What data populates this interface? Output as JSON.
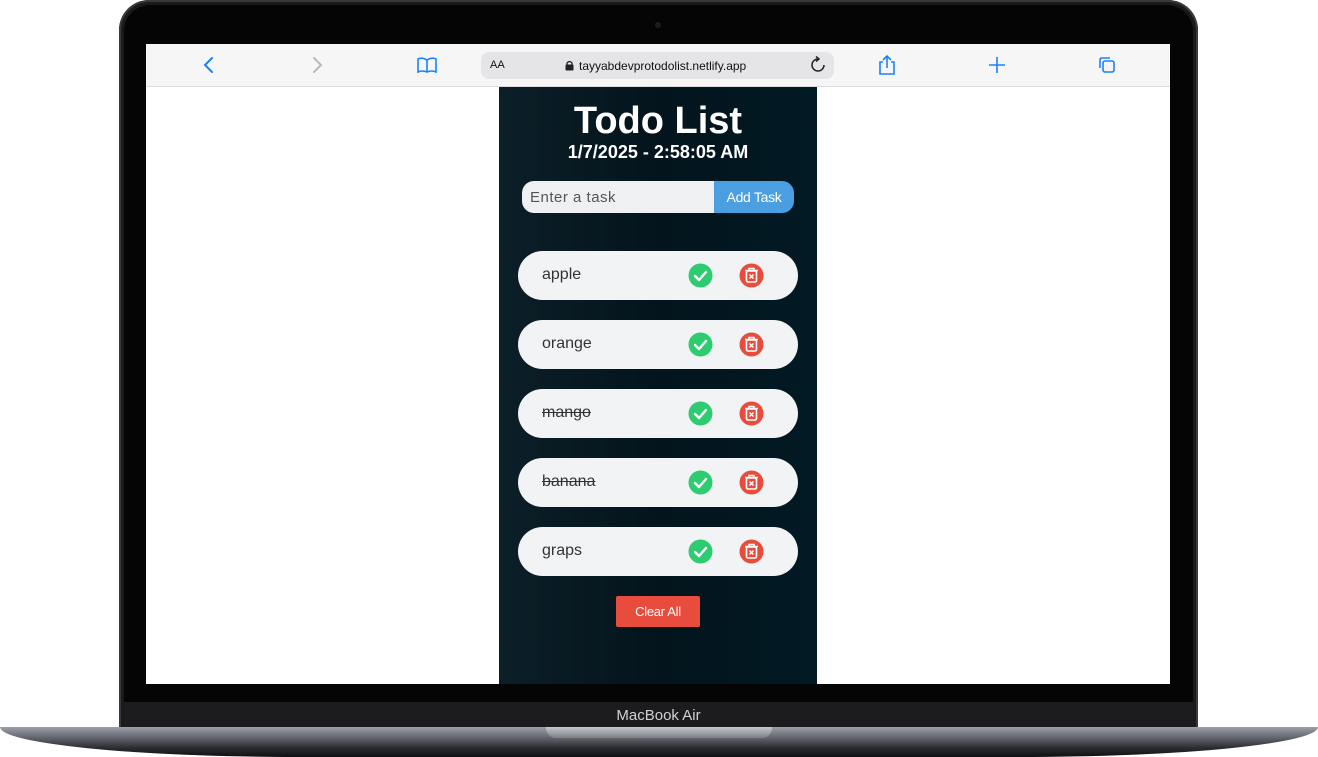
{
  "device": {
    "label": "MacBook Air"
  },
  "browser": {
    "text_size_label": "AA",
    "url": "tayyabdevprotodolist.netlify.app",
    "icons": [
      "chevron-left-icon",
      "chevron-right-icon",
      "book-icon",
      "lock-icon",
      "reload-icon",
      "share-icon",
      "plus-icon",
      "tabs-icon"
    ]
  },
  "app": {
    "title": "Todo List",
    "datetime": "1/7/2025 - 2:58:05 AM",
    "input_placeholder": "Enter a task",
    "add_button": "Add Task",
    "clear_button": "Clear All",
    "tasks": [
      {
        "text": "apple",
        "completed": false
      },
      {
        "text": "orange",
        "completed": false
      },
      {
        "text": "mango",
        "completed": true
      },
      {
        "text": "banana",
        "completed": true
      },
      {
        "text": "graps",
        "completed": false
      }
    ]
  },
  "colors": {
    "accent_blue": "#4b9fe0",
    "check_green": "#2ecc71",
    "delete_red": "#e74c3c",
    "app_background": "#03141c"
  }
}
